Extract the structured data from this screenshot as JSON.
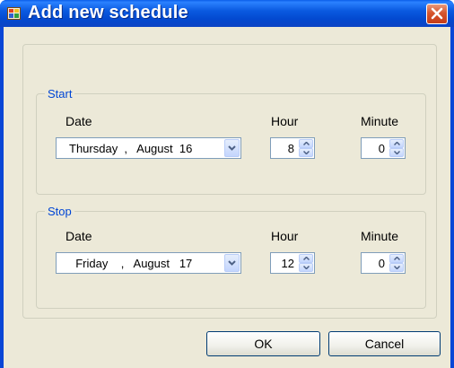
{
  "window": {
    "title": "Add new schedule",
    "title_icon": "app-icon",
    "close_icon": "close-icon"
  },
  "start": {
    "legend": "Start",
    "date_label": "Date",
    "hour_label": "Hour",
    "minute_label": "Minute",
    "date_value": "Thursday  ,   August  16",
    "hour_value": "8",
    "minute_value": "0"
  },
  "stop": {
    "legend": "Stop",
    "date_label": "Date",
    "hour_label": "Hour",
    "minute_label": "Minute",
    "date_value": "  Friday    ,   August   17",
    "hour_value": "12",
    "minute_value": "0"
  },
  "buttons": {
    "ok": "OK",
    "cancel": "Cancel"
  },
  "colors": {
    "titlebar": "#0a5ae0",
    "dialog_bg": "#ece9d8",
    "group_label": "#0046d5",
    "close_button": "#d6552d"
  }
}
